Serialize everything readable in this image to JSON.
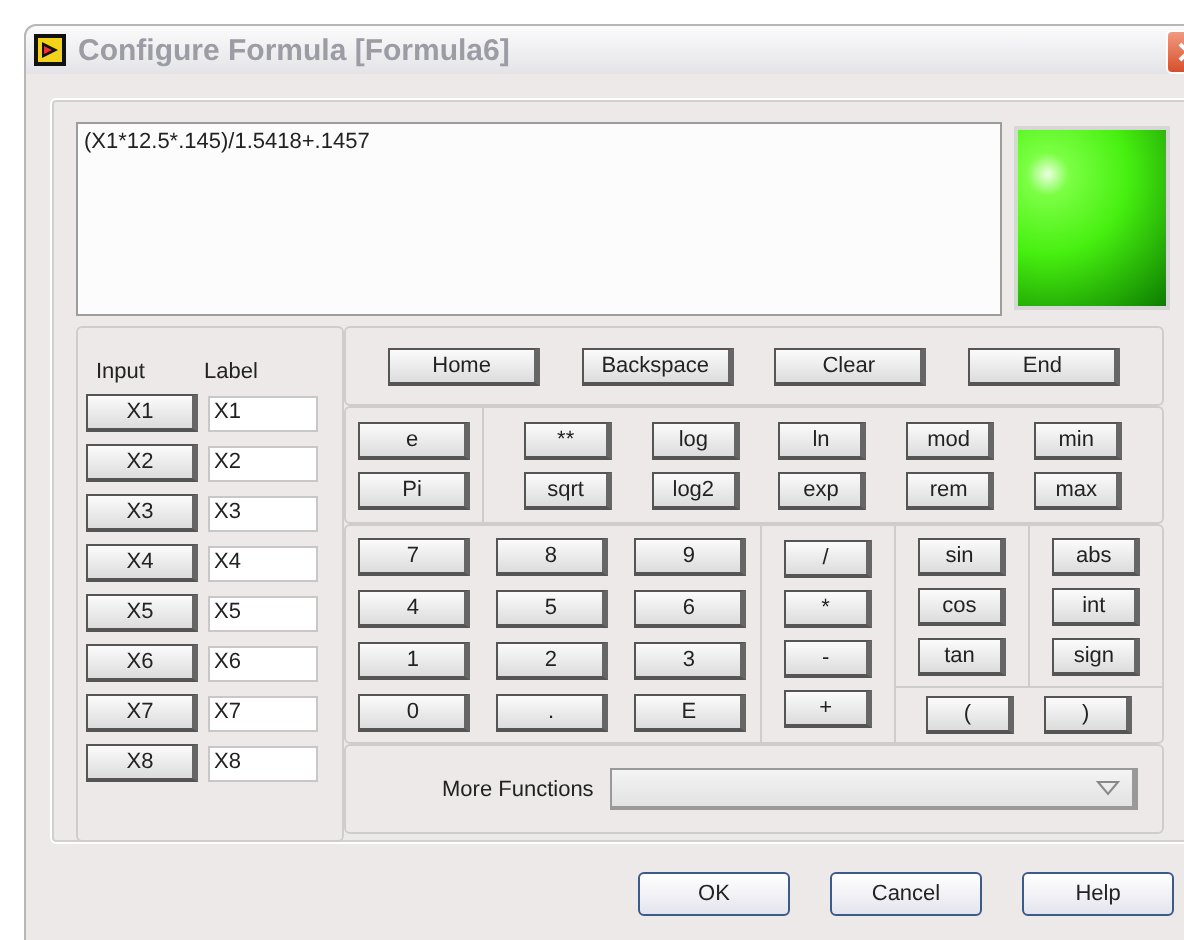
{
  "window": {
    "title": "Configure Formula [Formula6]"
  },
  "formula": {
    "value": "(X1*12.5*.145)/1.5418+.1457"
  },
  "indicator": {
    "on": true
  },
  "inputs": {
    "headers": [
      "Input",
      "Label"
    ],
    "rows": [
      {
        "button": "X1",
        "label": "X1"
      },
      {
        "button": "X2",
        "label": "X2"
      },
      {
        "button": "X3",
        "label": "X3"
      },
      {
        "button": "X4",
        "label": "X4"
      },
      {
        "button": "X5",
        "label": "X5"
      },
      {
        "button": "X6",
        "label": "X6"
      },
      {
        "button": "X7",
        "label": "X7"
      },
      {
        "button": "X8",
        "label": "X8"
      }
    ]
  },
  "edit_keys": [
    "Home",
    "Backspace",
    "Clear",
    "End"
  ],
  "constants": [
    "e",
    "Pi"
  ],
  "functions": [
    [
      "**",
      "sqrt"
    ],
    [
      "log",
      "log2"
    ],
    [
      "ln",
      "exp"
    ],
    [
      "mod",
      "rem"
    ],
    [
      "min",
      "max"
    ]
  ],
  "digits": [
    [
      "7",
      "8",
      "9"
    ],
    [
      "4",
      "5",
      "6"
    ],
    [
      "1",
      "2",
      "3"
    ],
    [
      "0",
      ".",
      "E"
    ]
  ],
  "operators": [
    "/",
    "*",
    "-",
    "+"
  ],
  "trig": [
    "sin",
    "cos",
    "tan"
  ],
  "misc": [
    "abs",
    "int",
    "sign"
  ],
  "parens": [
    "(",
    ")"
  ],
  "more_functions": {
    "label": "More Functions"
  },
  "dialog_buttons": [
    "OK",
    "Cancel",
    "Help"
  ]
}
